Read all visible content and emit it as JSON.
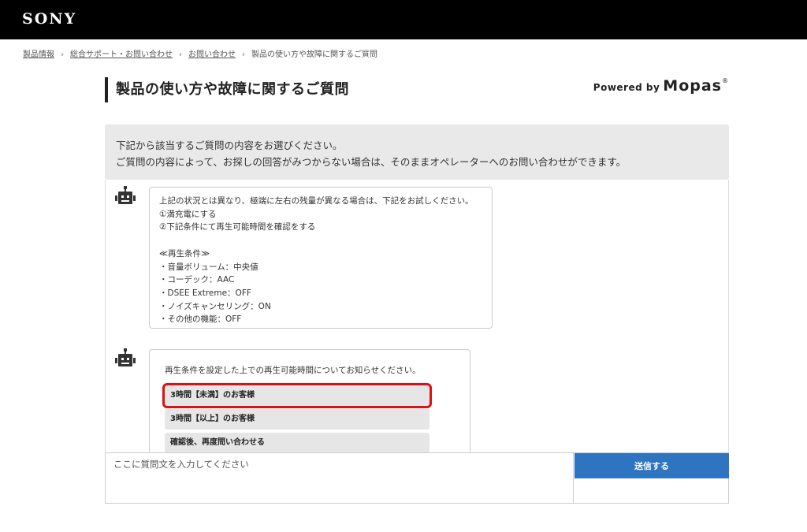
{
  "header": {
    "logo_text": "SONY"
  },
  "breadcrumb": {
    "items": [
      "製品情報",
      "総合サポート・お問い合わせ",
      "お問い合わせ"
    ],
    "current": "製品の使い方や故障に関するご質問",
    "separator": "›"
  },
  "page": {
    "title": "製品の使い方や故障に関するご質問",
    "powered_by": "Powered by",
    "powered_brand": "Mopas",
    "powered_reg": "®"
  },
  "notice": {
    "line1": "下記から該当するご質問の内容をお選びください。",
    "line2": "ご質問の内容によって、お探しの回答がみつからない場合は、そのままオペレーターへのお問い合わせができます。"
  },
  "chat": {
    "message1": {
      "lines": [
        "上記の状況とは異なり、極端に左右の残量が異なる場合は、下記をお試しください。",
        "①満充電にする",
        "②下記条件にて再生可能時間を確認をする",
        "",
        "≪再生条件≫",
        "・音量ボリューム：中央値",
        "・コーデック：AAC",
        "・DSEE Extreme：OFF",
        "・ノイズキャンセリング：ON",
        "・その他の機能：OFF"
      ]
    },
    "message2": {
      "question": "再生条件を設定した上での再生可能時間についてお知らせください。",
      "options": [
        "3時間【未満】のお客様",
        "3時間【以上】のお客様",
        "確認後、再度問い合わせる"
      ]
    }
  },
  "input": {
    "placeholder": "ここに質問文を入力してください",
    "send_label": "送信する"
  },
  "colors": {
    "header_bg": "#000000",
    "send_button": "#2f74c0",
    "highlight": "#dd1111",
    "notice_bg": "#e9e9e9"
  },
  "icons": {
    "bot": "robot-icon"
  }
}
